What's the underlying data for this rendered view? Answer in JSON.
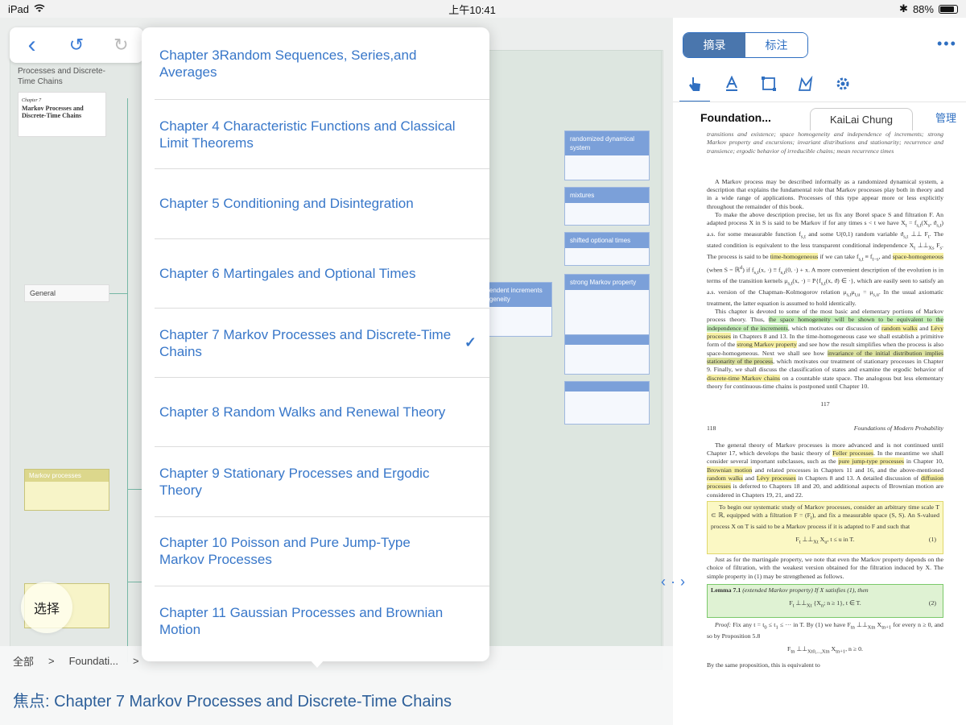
{
  "status": {
    "device": "iPad",
    "time": "上午10:41",
    "battery": "88%"
  },
  "toolbar": {
    "back": "‹",
    "undo": "↺",
    "redo": "↻"
  },
  "mindmap": {
    "root_title": "Processes and Discrete-Time Chains",
    "thumb": {
      "caption": "Chapter 7",
      "title": "Markov Processes and Discrete-Time Chains"
    },
    "general_label": "General",
    "yellow_nodes": [
      {
        "title": "Markov processes"
      }
    ],
    "blue_nodes": [
      {
        "title": "randomized dynamical system"
      },
      {
        "title": "mixtures"
      },
      {
        "title": "shifted optional times"
      },
      {
        "title": "strong Markov property"
      },
      {
        "title": ""
      },
      {
        "title": ""
      }
    ],
    "left_blue_node": {
      "title": "ependent increments nogeneity"
    }
  },
  "select_button": "选择",
  "breadcrumb": {
    "all": "全部",
    "sep": ">",
    "item": "Foundati...",
    "sep2": ">"
  },
  "focus": {
    "label": "焦点:",
    "value": "Chapter 7 Markov Processes and Discrete-Time Chains"
  },
  "chapters": [
    {
      "title": "Chapter 3Random Sequences, Series,and Averages",
      "selected": false
    },
    {
      "title": "Chapter 4 Characteristic Functions and Classical Limit Theorems",
      "selected": false
    },
    {
      "title": "Chapter 5 Conditioning and Disintegration",
      "selected": false
    },
    {
      "title": "Chapter 6 Martingales and Optional Times",
      "selected": false
    },
    {
      "title": "Chapter 7 Markov Processes and Discrete-Time Chains",
      "selected": true
    },
    {
      "title": "Chapter 8 Random Walks and Renewal Theory",
      "selected": false
    },
    {
      "title": "Chapter 9 Stationary Processes and Ergodic Theory",
      "selected": false
    },
    {
      "title": "Chapter 10 Poisson and Pure Jump-Type Markov Processes",
      "selected": false
    },
    {
      "title": "Chapter 11 Gaussian Processes and Brownian Motion",
      "selected": false
    }
  ],
  "check_mark": "✓",
  "splitter": {
    "left": "‹",
    "dot": "·",
    "right": "›"
  },
  "right": {
    "segments": {
      "excerpt": "摘录",
      "annotate": "标注"
    },
    "more": "•••",
    "doc_tab_active": "Foundation...",
    "doc_tab_other": "KaiLai Chung",
    "manage": "管理"
  },
  "pdf": {
    "intro": "transitions and existence; space homogeneity and independence of increments; strong Markov property and excursions; invariant distributions and stationarity; recurrence and transience; ergodic behavior of irreducible chains; mean recurrence times",
    "p1": "A Markov process may be described informally as a randomized dynamical system, a description that explains the fundamental role that Markov processes play both in theory and in a wide range of applications. Processes of this type appear more or less explicitly throughout the remainder of this book.",
    "p2a": "To make the above description precise, let us fix any Borel space S and filtration F. An adapted process X in S is said to be Markov if for any times s < t we have X",
    "p2b": " = f",
    "p2c": "(X",
    "p2d": ", ϑ",
    "p2e": ") a.s. for some measurable function f",
    "p2f": " and some U(0,1) random variable ϑ",
    "p2g": " ⊥⊥ F",
    "p2h": ". The stated condition is equivalent to the less transparent conditional independence X",
    "p2i": " ⊥⊥",
    "p2j": " F",
    "p2k": ". The process is said to be ",
    "hl_time_homogeneous": "time-homogeneous",
    "p2l": " if we can take f",
    "p2m": " ≡ f",
    "p2n": ", and ",
    "hl_space_homogeneous": "space-homogeneous",
    "p2o": " (when S = ℝ",
    "p2p": ") if f",
    "p2q": "(x, ·) ≡ f",
    "p2r": "(0, ·) + x. A more convenient description of the evolution is in terms of the transition kernels μ",
    "p2s": "(x, ·) = P{f",
    "p2t": "(x, ϑ) ∈ ·}, which are easily seen to satisfy an a.s. version of the Chapman–Kolmogorov relation μ",
    "p2u": "μ",
    "p2v": " = μ",
    "p2w": ". In the usual axiomatic treatment, the latter equation is assumed to hold identically.",
    "p3a": "This chapter is devoted to some of the most basic and elementary portions of Markov process theory. Thus, ",
    "hl_g1": "the space homogeneity will be shown to be equivalent to the independence of the increments",
    "p3b": ", which motivates our discussion of ",
    "hl_random_walks": "random walks",
    "p3c": " and ",
    "hl_levy": "Lévy processes",
    "p3d": " in Chapters 8 and 13. In the time-homogeneous case we shall establish a primitive form of the ",
    "hl_strong": "strong Markov property",
    "p3e": " and see how the result simplifies when the process is also space-homogeneous. Next we shall see how ",
    "hl_invariance": "invariance of the initial distribution implies stationarity of the process",
    "p3f": ", which motivates our treatment of stationary processes in Chapter 9. Finally, we shall discuss the classification of states and examine the ergodic behavior of ",
    "hl_discrete": "discrete-time Markov chains",
    "p3g": " on a countable state space. The analogous but less elementary theory for continuous-time chains is postponed until Chapter 10.",
    "page117": "117",
    "page118": "118",
    "runhead": "Foundations of Modern Probability",
    "p4a": "The general theory of Markov processes is more advanced and is not continued until Chapter 17, which develops the basic theory of ",
    "hl_feller": "Feller processes",
    "p4b": ". In the meantime we shall consider several important subclasses, such as the ",
    "hl_pure_jump": "pure jump-type processes",
    "p4c": " in Chapter 10, ",
    "hl_brownian": "Brownian motion",
    "p4d": " and related processes in Chapters 11 and 16, and the above-mentioned ",
    "hl_random_walks2": "random walks",
    "p4e": " and ",
    "hl_levy2": "Lévy processes",
    "p4f": " in Chapters 8 and 13. A detailed discussion of ",
    "hl_diffusion": "diffusion processes",
    "p4g": " is deferred to Chapters 18 and 20, and additional aspects of Brownian motion are considered in Chapters 19, 21, and 22.",
    "p5": "To begin our systematic study of Markov processes, consider an arbitrary time scale T ⊂ ℝ, equipped with a filtration F = (F",
    "p5b": "), and fix a measurable space (S, S). An S-valued process X on T is said to be a Markov process if it is adapted to F and such that",
    "eq1": "F",
    "eq1b": " ⊥⊥",
    "eq1c": " X",
    "eq1d": ",   t ≤ u in T.",
    "eq1_no": "(1)",
    "p6": "Just as for the martingale property, we note that even the Markov property depends on the choice of filtration, with the weakest version obtained for the filtration induced by X. The simple property in (1) may be strengthened as follows.",
    "lemma_head": "Lemma 7.1",
    "lemma_name": "(extended Markov property)",
    "lemma_text": "If X satisfies (1), then",
    "eq2": "F",
    "eq2b": " ⊥⊥",
    "eq2c": " {X",
    "eq2d": "; n ≥ 1},   t ∈ T.",
    "eq2_no": "(2)",
    "proof_label": "Proof:",
    "p7": " Fix any t = t",
    "p7b": " ≤ t",
    "p7c": " ≤ ··· in T. By (1) we have F",
    "p7d": " ⊥⊥",
    "p7e": " X",
    "p7f": " for every n ≥ 0, and so by Proposition 5.8",
    "eq3": "F",
    "eq3b": " ⊥⊥",
    "eq3c": " X",
    "eq3d": ",   n ≥ 0.",
    "p8": "By the same proposition, this is equivalent to"
  }
}
